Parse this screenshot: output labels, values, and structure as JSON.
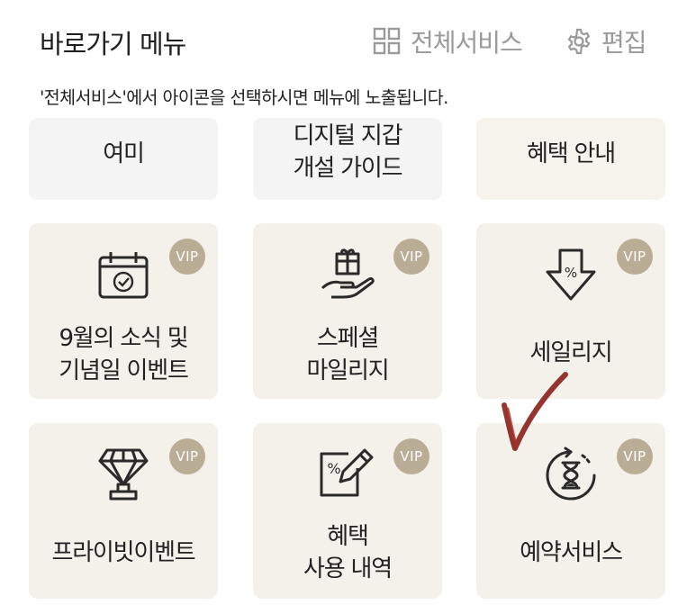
{
  "header": {
    "title": "바로가기 메뉴",
    "all_services_label": "전체서비스",
    "edit_label": "편집"
  },
  "notice": "'전체서비스'에서 아이콘을 선택하시면 메뉴에 노출됩니다.",
  "tiles": [
    {
      "label": "여미",
      "vip": false
    },
    {
      "label": "디지털 지갑\n개설 가이드",
      "vip": false
    },
    {
      "label": "혜택 안내",
      "vip": false
    },
    {
      "label": "9월의 소식 및\n기념일 이벤트",
      "vip": true,
      "badge": "VIP",
      "icon": "calendar-check-icon"
    },
    {
      "label": "스페셜\n마일리지",
      "vip": true,
      "badge": "VIP",
      "icon": "gift-hand-icon"
    },
    {
      "label": "세일리지",
      "vip": true,
      "badge": "VIP",
      "icon": "discount-arrow-icon"
    },
    {
      "label": "프라이빗이벤트",
      "vip": true,
      "badge": "VIP",
      "icon": "diamond-trophy-icon"
    },
    {
      "label": "혜택\n사용 내역",
      "vip": true,
      "badge": "VIP",
      "icon": "coupon-pencil-icon"
    },
    {
      "label": "예약서비스",
      "vip": true,
      "badge": "VIP",
      "icon": "hourglass-refresh-icon"
    }
  ],
  "colors": {
    "tile_bg": "#f4f1ea",
    "tile_plain_bg": "#f4f4f4",
    "vip_badge": "#b9ad96",
    "muted_text": "#9a9a9a",
    "handwritten_mark": "#8b1f1a"
  }
}
